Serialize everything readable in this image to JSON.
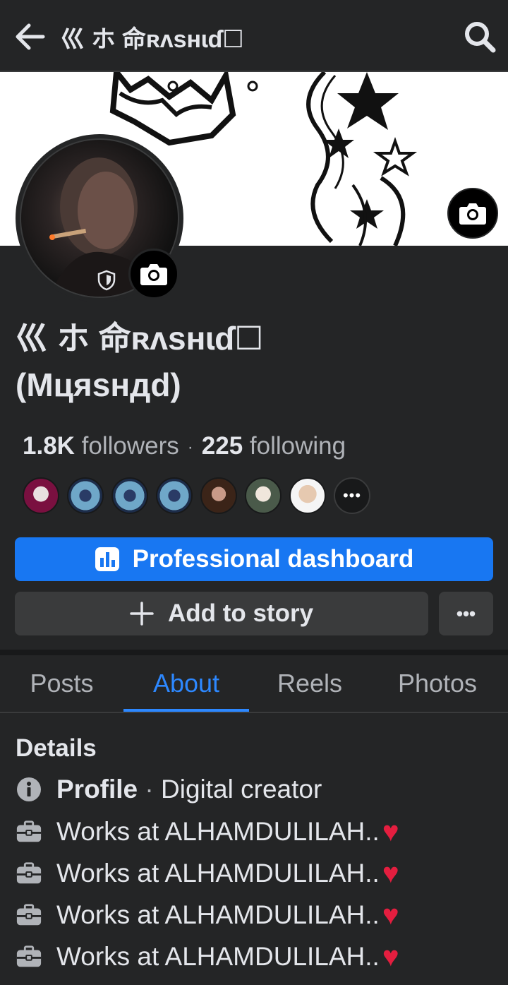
{
  "topbar": {
    "title": "巛 ホ 命ʀᴧѕʜɩɗ☐"
  },
  "profile": {
    "name_line1": "巛 ホ 命ʀᴧѕʜɩɗ☐",
    "name_line2": "(Мцяsндd)",
    "followers_count": "1.8K",
    "followers_label": "followers",
    "following_count": "225",
    "following_label": "following",
    "more_friends": "•••"
  },
  "buttons": {
    "pro_dashboard": "Professional dashboard",
    "add_story": "Add to story",
    "more": "•••"
  },
  "tabs": [
    {
      "label": "Posts",
      "active": false
    },
    {
      "label": "About",
      "active": true
    },
    {
      "label": "Reels",
      "active": false
    },
    {
      "label": "Photos",
      "active": false
    }
  ],
  "details": {
    "title": "Details",
    "profile_label": "Profile",
    "profile_sep": " · ",
    "profile_value": "Digital creator",
    "works": [
      {
        "text": "Works at ALHAMDULILAH..",
        "emoji": "♥"
      },
      {
        "text": "Works at ALHAMDULILAH..",
        "emoji": "♥"
      },
      {
        "text": "Works at ALHAMDULILAH..",
        "emoji": "♥"
      },
      {
        "text": "Works at ALHAMDULILAH..",
        "emoji": "♥"
      }
    ]
  },
  "colors": {
    "accent": "#1877f2",
    "tab_active": "#2d88ff",
    "background": "#242526",
    "heart": "#e41e3f"
  },
  "icons": [
    "back-arrow-icon",
    "search-icon",
    "camera-icon",
    "shield-icon",
    "chart-icon",
    "plus-icon",
    "info-icon",
    "briefcase-icon"
  ]
}
